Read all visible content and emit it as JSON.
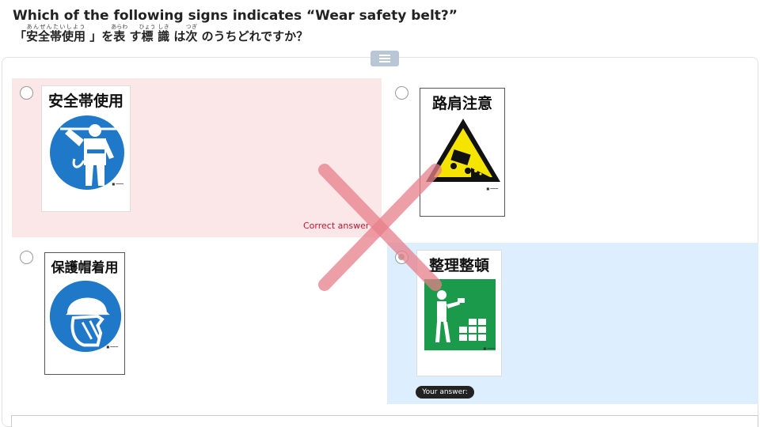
{
  "question": {
    "english": "Which of the following signs indicates “Wear safety belt?”",
    "japanese_parts": [
      {
        "base": "「",
        "ruby": ""
      },
      {
        "base": "安全帯使用",
        "ruby": "あんぜんたいしよう"
      },
      {
        "base": " 」を",
        "ruby": ""
      },
      {
        "base": "表",
        "ruby": "あらわ"
      },
      {
        "base": " す",
        "ruby": ""
      },
      {
        "base": "標",
        "ruby": "ひょう"
      },
      {
        "base": " ",
        "ruby": ""
      },
      {
        "base": "識",
        "ruby": "しき"
      },
      {
        "base": " は",
        "ruby": ""
      },
      {
        "base": "次",
        "ruby": "つぎ"
      },
      {
        "base": " のうちどれですか？",
        "ruby": ""
      }
    ]
  },
  "choices": [
    {
      "sign_title": "安全帯使用",
      "icon": "safety-belt-icon",
      "correct": true,
      "selected": false
    },
    {
      "sign_title": "路肩注意",
      "icon": "road-shoulder-warning-icon",
      "correct": false,
      "selected": false
    },
    {
      "sign_title": "保護帽着用",
      "icon": "hard-hat-icon",
      "correct": false,
      "selected": false
    },
    {
      "sign_title": "整理整頓",
      "icon": "tidy-up-icon",
      "correct": false,
      "selected": true
    }
  ],
  "labels": {
    "correct_answer": "Correct answer",
    "your_answer": "Your answer:"
  },
  "colors": {
    "correct_bg": "#fbe6e8",
    "selected_bg": "#ddeeff",
    "mandatory_blue": "#1f78c8",
    "warning_yellow": "#f5e300",
    "safety_green": "#1a9a4a",
    "wrong_mark": "#e8808a"
  }
}
